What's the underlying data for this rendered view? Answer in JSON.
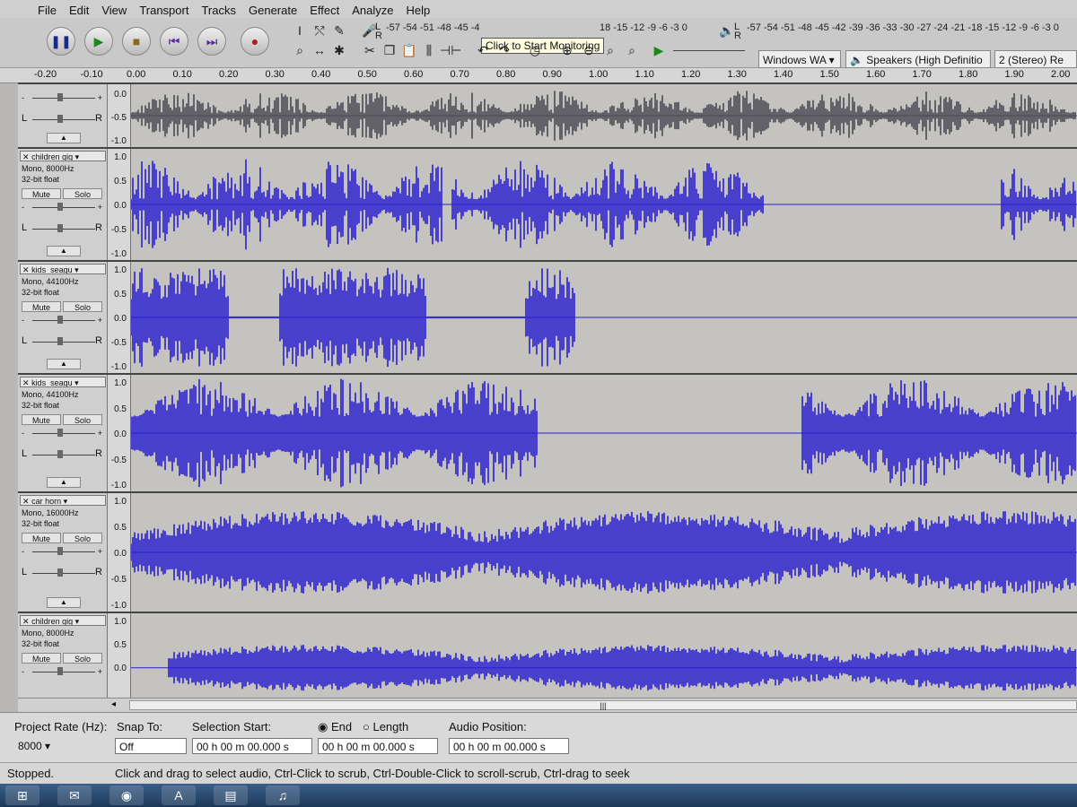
{
  "menu": [
    "File",
    "Edit",
    "View",
    "Transport",
    "Tracks",
    "Generate",
    "Effect",
    "Analyze",
    "Help"
  ],
  "transport": {
    "pause_icon": "pause-icon",
    "play_icon": "play-icon",
    "stop_icon": "stop-icon",
    "skip_start_icon": "skip-start-icon",
    "skip_end_icon": "skip-end-icon",
    "record_icon": "record-icon"
  },
  "meters": {
    "record_l_label": "L",
    "record_r_label": "R",
    "record_scale": "-57 -54 -51 -48 -45 -4",
    "record_scale_right": "18 -15 -12 -9 -6 -3 0",
    "tooltip": "Click to Start Monitoring",
    "playback_scale": "-57 -54 -51 -48 -45 -42 -39 -36 -33 -30 -27 -24 -21 -18 -15 -12 -9 -6 -3 0",
    "playback_l_label": "L",
    "playback_r_label": "R"
  },
  "devices": {
    "host": "Windows WA",
    "output": "Speakers (High Definitio",
    "channels": "2 (Stereo) Re"
  },
  "ruler": [
    "-0.20",
    "-0.10",
    "0.00",
    "0.10",
    "0.20",
    "0.30",
    "0.40",
    "0.50",
    "0.60",
    "0.70",
    "0.80",
    "0.90",
    "1.00",
    "1.10",
    "1.20",
    "1.30",
    "1.40",
    "1.50",
    "1.60",
    "1.70",
    "1.80",
    "1.90",
    "2.00"
  ],
  "tracks": [
    {
      "name": "",
      "rate": "",
      "format": "",
      "scale": [
        "0.0",
        "-0.5",
        "-1.0"
      ],
      "mute": "",
      "solo": "",
      "gain_minus": "-",
      "gain_plus": "+",
      "pan_l": "L",
      "pan_r": "R"
    },
    {
      "name": "children gig",
      "rate": "Mono, 8000Hz",
      "format": "32-bit float",
      "scale": [
        "1.0",
        "0.5",
        "0.0",
        "-0.5",
        "-1.0"
      ],
      "mute": "Mute",
      "solo": "Solo",
      "gain_minus": "-",
      "gain_plus": "+",
      "pan_l": "L",
      "pan_r": "R"
    },
    {
      "name": "kids_seagu",
      "rate": "Mono, 44100Hz",
      "format": "32-bit float",
      "scale": [
        "1.0",
        "0.5",
        "0.0",
        "-0.5",
        "-1.0"
      ],
      "mute": "Mute",
      "solo": "Solo",
      "gain_minus": "-",
      "gain_plus": "+",
      "pan_l": "L",
      "pan_r": "R"
    },
    {
      "name": "kids_seagu",
      "rate": "Mono, 44100Hz",
      "format": "32-bit float",
      "scale": [
        "1.0",
        "0.5",
        "0.0",
        "-0.5",
        "-1.0"
      ],
      "mute": "Mute",
      "solo": "Solo",
      "gain_minus": "-",
      "gain_plus": "+",
      "pan_l": "L",
      "pan_r": "R"
    },
    {
      "name": "car horn",
      "rate": "Mono, 16000Hz",
      "format": "32-bit float",
      "scale": [
        "1.0",
        "0.5",
        "0.0",
        "-0.5",
        "-1.0"
      ],
      "mute": "Mute",
      "solo": "Solo",
      "gain_minus": "-",
      "gain_plus": "+",
      "pan_l": "L",
      "pan_r": "R"
    },
    {
      "name": "children gig",
      "rate": "Mono, 8000Hz",
      "format": "32-bit float",
      "scale": [
        "1.0",
        "0.5",
        "0.0"
      ],
      "mute": "Mute",
      "solo": "Solo",
      "gain_minus": "-",
      "gain_plus": "+",
      "pan_l": "",
      "pan_r": ""
    }
  ],
  "scrollbar_grip": "|||",
  "selection": {
    "project_rate_label": "Project Rate (Hz):",
    "project_rate_value": "8000",
    "snap_label": "Snap To:",
    "snap_value": "Off",
    "start_label": "Selection Start:",
    "start_value": "00 h 00 m 00.000 s",
    "end_label": "End",
    "length_label": "Length",
    "end_value": "00 h 00 m 00.000 s",
    "position_label": "Audio Position:",
    "position_value": "00 h 00 m 00.000 s"
  },
  "status": {
    "state": "Stopped.",
    "hint": "Click and drag to select audio, Ctrl-Click to scrub, Ctrl-Double-Click to scroll-scrub, Ctrl-drag to seek"
  },
  "colors": {
    "wave": "#2a1fd0",
    "wave_dark": "#4a4a52",
    "bg": "#c4c3c0"
  },
  "taskbar": [
    "windows-start-icon",
    "outlook-icon",
    "chrome-icon",
    "acrobat-icon",
    "files-icon",
    "audacity-icon"
  ]
}
